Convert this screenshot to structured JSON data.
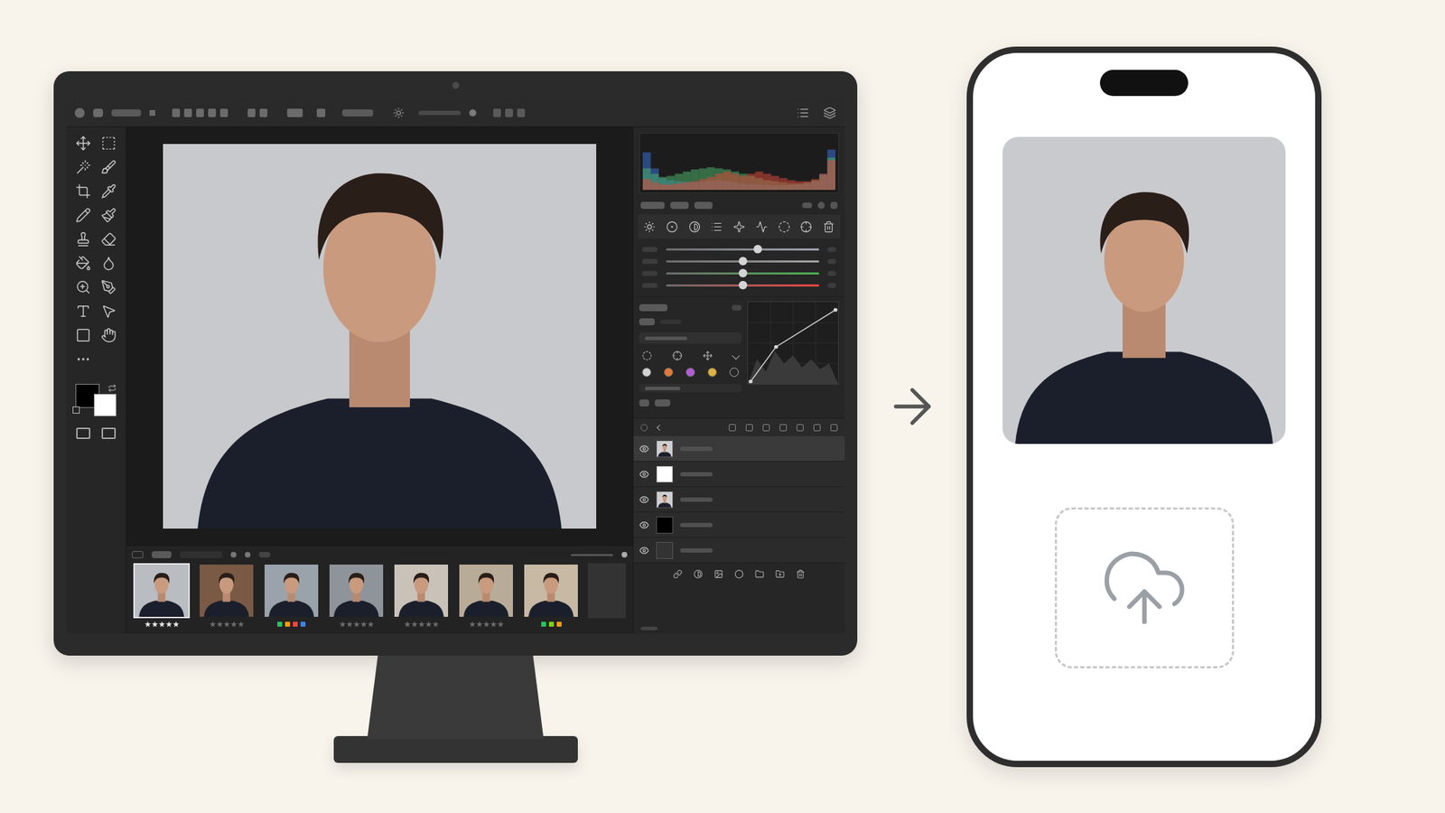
{
  "editor": {
    "canvas": {
      "photo": {
        "background": "#c8c9cc"
      }
    },
    "colors": {
      "foreground": "#000000",
      "background": "#ffffff"
    },
    "histogram": {
      "series": [
        {
          "name": "blue",
          "color": "#3b6fd1",
          "values": [
            70,
            40,
            22,
            18,
            16,
            15,
            14,
            15,
            17,
            18,
            16,
            14,
            12,
            11,
            10,
            9,
            8,
            8,
            9,
            10,
            12,
            16,
            30,
            75
          ]
        },
        {
          "name": "green",
          "color": "#4caf6a",
          "values": [
            40,
            30,
            24,
            26,
            30,
            34,
            38,
            40,
            42,
            40,
            38,
            34,
            30,
            26,
            22,
            18,
            16,
            14,
            12,
            12,
            14,
            18,
            28,
            60
          ]
        },
        {
          "name": "red",
          "color": "#d9483b",
          "values": [
            20,
            14,
            10,
            10,
            12,
            14,
            16,
            20,
            24,
            30,
            34,
            30,
            26,
            30,
            34,
            30,
            26,
            22,
            18,
            16,
            16,
            20,
            30,
            55
          ]
        }
      ]
    },
    "sliders": [
      {
        "level": 0.6,
        "color": "#9ca3af"
      },
      {
        "level": 0.5,
        "color": "#a3a3a3"
      },
      {
        "level": 0.5,
        "color": "#4caf50"
      },
      {
        "level": 0.5,
        "color": "#ef4444"
      }
    ],
    "curve": {
      "points": [
        [
          0,
          0
        ],
        [
          0.3,
          0.45
        ],
        [
          1,
          0.93
        ]
      ]
    },
    "swatches": [
      "#d4d4d4",
      "#e07a3b",
      "#b45cd6",
      "#e0b13b"
    ],
    "filmstrip": [
      {
        "selected": true,
        "color": "#b9bcc0",
        "kind": "stars",
        "stars": 5,
        "labels": []
      },
      {
        "selected": false,
        "color": "#7a5a44",
        "kind": "stars",
        "stars": 0,
        "labels": []
      },
      {
        "selected": false,
        "color": "#9aa3ab",
        "kind": "labels",
        "stars": 0,
        "labels": [
          "#22c55e",
          "#f59e0b",
          "#ef4444",
          "#3b82f6"
        ]
      },
      {
        "selected": false,
        "color": "#8e949a",
        "kind": "stars",
        "stars": 0,
        "labels": []
      },
      {
        "selected": false,
        "color": "#c9c2b8",
        "kind": "stars",
        "stars": 0,
        "labels": []
      },
      {
        "selected": false,
        "color": "#b8ab98",
        "kind": "stars",
        "stars": 0,
        "labels": []
      },
      {
        "selected": false,
        "color": "#c7b9a3",
        "kind": "labels",
        "stars": 0,
        "labels": [
          "#22c55e",
          "#84cc16",
          "#f59e0b"
        ]
      }
    ],
    "layers": [
      {
        "visible": true,
        "selected": true,
        "kind": "photo"
      },
      {
        "visible": true,
        "selected": false,
        "kind": "white"
      },
      {
        "visible": true,
        "selected": false,
        "kind": "photo"
      },
      {
        "visible": true,
        "selected": false,
        "kind": "black"
      },
      {
        "visible": true,
        "selected": false,
        "kind": "empty"
      }
    ]
  },
  "phone": {
    "photo": {
      "background": "#c9cacd"
    },
    "upload_zone": {
      "empty": true
    }
  }
}
